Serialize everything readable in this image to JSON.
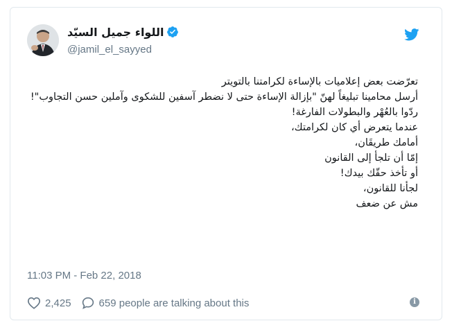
{
  "tweet": {
    "author": {
      "display_name": "اللواء جميل السيّد",
      "handle": "@jamil_el_sayyed",
      "verified": true
    },
    "body_lines": [
      "تعرّضت بعض إعلاميات بالإساءة لكرامتنا بالتويتر",
      "أرسل محامينا تبليغاً لهنّ \"بإزالة الإساءة حتى لا نضطر آسفين للشكوى وآملين حسن التجاوب\"!",
      "ردّوا بالعُهْر والبطولات الفارغة!",
      "عندما يتعرض أي كان لكرامتك،",
      "أمامك طريقَان،",
      "إمّا أن تلجأ إلى القانون",
      "أو تأخذ حقّك بيدك!",
      "لجأنا للقانون،",
      "مش عن ضعف"
    ],
    "timestamp": "11:03 PM - Feb 22, 2018",
    "likes": "2,425",
    "replies_text": "659 people are talking about this"
  },
  "colors": {
    "twitter_blue": "#1da1f2",
    "muted": "#657786",
    "border": "#e1e8ed"
  }
}
